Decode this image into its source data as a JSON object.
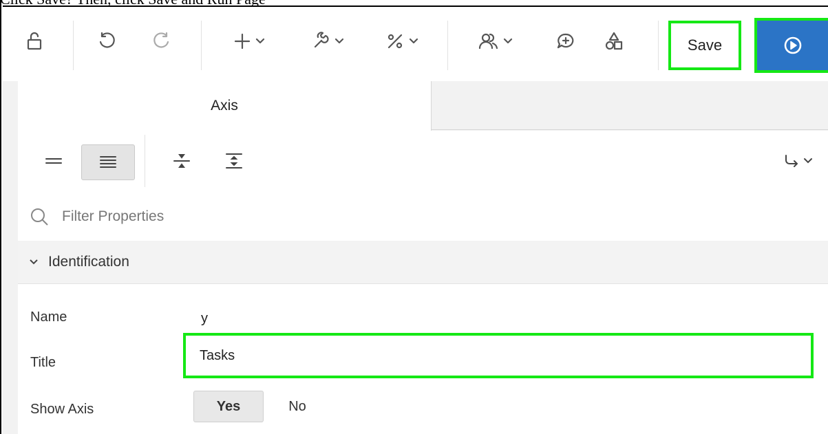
{
  "caption": "Click Save? Then, click Save and Run Page",
  "toolbar": {
    "icons": [
      "unlock-icon",
      "undo-icon",
      "redo-icon",
      "add-icon",
      "utilities-icon",
      "shared-components-icon",
      "team-dev-icon",
      "comment-icon",
      "shapes-icon",
      "run-icon"
    ],
    "save_label": "Save"
  },
  "tabs": [
    {
      "label": "Axis"
    }
  ],
  "filter": {
    "placeholder": "Filter Properties"
  },
  "section": {
    "label": "Identification"
  },
  "properties": {
    "name": {
      "label": "Name",
      "value": "y"
    },
    "title": {
      "label": "Title",
      "value": "Tasks"
    },
    "show_axis": {
      "label": "Show Axis",
      "yes": "Yes",
      "no": "No"
    }
  },
  "colors": {
    "highlight": "#15e815",
    "run_button": "#2b74c6"
  }
}
